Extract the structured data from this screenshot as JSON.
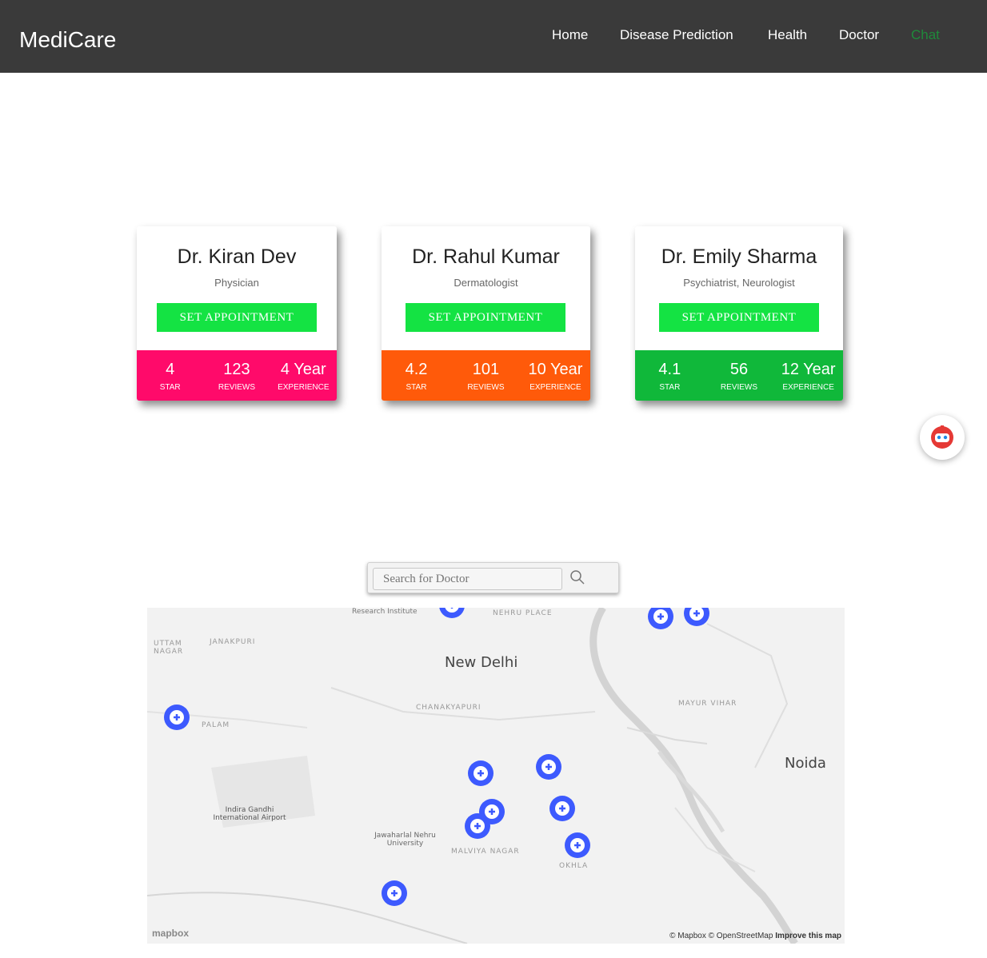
{
  "navbar": {
    "brand": "MediCare",
    "links": [
      {
        "label": "Home"
      },
      {
        "label": "Disease Prediction"
      },
      {
        "label": "Health"
      },
      {
        "label": "Doctor"
      },
      {
        "label": "Chat"
      }
    ]
  },
  "doctors": [
    {
      "name": "Dr. Kiran Dev",
      "specialty": "Physician",
      "button": "SET APPOINTMENT",
      "color": "#ff0a6a",
      "stats": [
        {
          "value": "4",
          "label": "STAR"
        },
        {
          "value": "123",
          "label": "REVIEWS"
        },
        {
          "value": "4 Year",
          "label": "EXPERIENCE"
        }
      ]
    },
    {
      "name": "Dr. Rahul Kumar",
      "specialty": "Dermatologist",
      "button": "SET APPOINTMENT",
      "color": "#ff5a0a",
      "stats": [
        {
          "value": "4.2",
          "label": "STAR"
        },
        {
          "value": "101",
          "label": "REVIEWS"
        },
        {
          "value": "10 Year",
          "label": "EXPERIENCE"
        }
      ]
    },
    {
      "name": "Dr. Emily Sharma",
      "specialty": "Psychiatrist, Neurologist",
      "button": "SET APPOINTMENT",
      "color": "#10b83a",
      "stats": [
        {
          "value": "4.1",
          "label": "STAR"
        },
        {
          "value": "56",
          "label": "REVIEWS"
        },
        {
          "value": "12 Year",
          "label": "EXPERIENCE"
        }
      ]
    }
  ],
  "search": {
    "placeholder": "Search for Doctor"
  },
  "map": {
    "labels": {
      "new_delhi": "New Delhi",
      "noida": "Noida",
      "airport": "Indira Gandhi International Airport",
      "jnu": "Jawaharlal Nehru University",
      "research": "Research Institute",
      "nehru_place": "NEHRU PLACE",
      "palam": "PALAM",
      "janakpuri": "JANAKPURI",
      "uttam_nagar": "UTTAM NAGAR",
      "malviya": "MALVIYA NAGAR",
      "chanakyapuri": "CHANAKYAPURI",
      "mayur": "MAYUR VIHAR",
      "okhla": "OKHLA"
    },
    "attribution": {
      "mapbox": "© Mapbox",
      "osm": "© OpenStreetMap",
      "improve": "Improve this map"
    },
    "logo": "mapbox"
  }
}
